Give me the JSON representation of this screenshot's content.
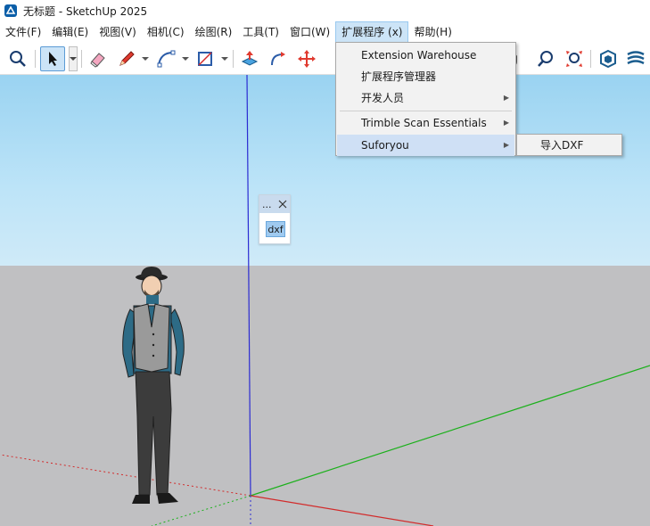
{
  "window": {
    "title": "无标题 - SketchUp 2025"
  },
  "menubar": [
    {
      "label": "文件(F)"
    },
    {
      "label": "编辑(E)"
    },
    {
      "label": "视图(V)"
    },
    {
      "label": "相机(C)"
    },
    {
      "label": "绘图(R)"
    },
    {
      "label": "工具(T)"
    },
    {
      "label": "窗口(W)"
    },
    {
      "label": "扩展程序 (x)"
    },
    {
      "label": "帮助(H)"
    }
  ],
  "toolbar": {
    "tools": [
      {
        "icon": "search-icon"
      },
      {
        "icon": "select-arrow-icon"
      },
      {
        "icon": "eraser-icon"
      },
      {
        "icon": "pencil-icon"
      },
      {
        "icon": "arc-icon"
      },
      {
        "icon": "rectangle-icon"
      },
      {
        "icon": "push-pull-icon"
      },
      {
        "icon": "follow-me-icon"
      },
      {
        "icon": "move-icon"
      },
      {
        "icon": "rotate-icon"
      },
      {
        "icon": "orbit-icon"
      },
      {
        "icon": "zoom-icon"
      },
      {
        "icon": "zoom-extents-icon"
      },
      {
        "icon": "extension-warehouse-icon"
      },
      {
        "icon": "layers-icon"
      }
    ]
  },
  "extensions_menu": {
    "items": [
      {
        "label": "Extension Warehouse",
        "has_submenu": false
      },
      {
        "label": "扩展程序管理器",
        "has_submenu": false
      },
      {
        "label": "开发人员",
        "has_submenu": true
      },
      {
        "label": "Trimble Scan Essentials",
        "has_submenu": true
      },
      {
        "label": "Suforyou",
        "has_submenu": true
      }
    ],
    "submenu": {
      "items": [
        {
          "label": "导入DXF"
        }
      ]
    }
  },
  "float_panel": {
    "title": "...",
    "button": "dxf"
  },
  "colors": {
    "sky_top": "#9ad3f1",
    "ground": "#c0c0c2",
    "axis_red": "#d22b2b",
    "axis_green": "#1bb01b",
    "axis_blue": "#2b2bd2",
    "menu_highlight": "#cfe0f5"
  }
}
